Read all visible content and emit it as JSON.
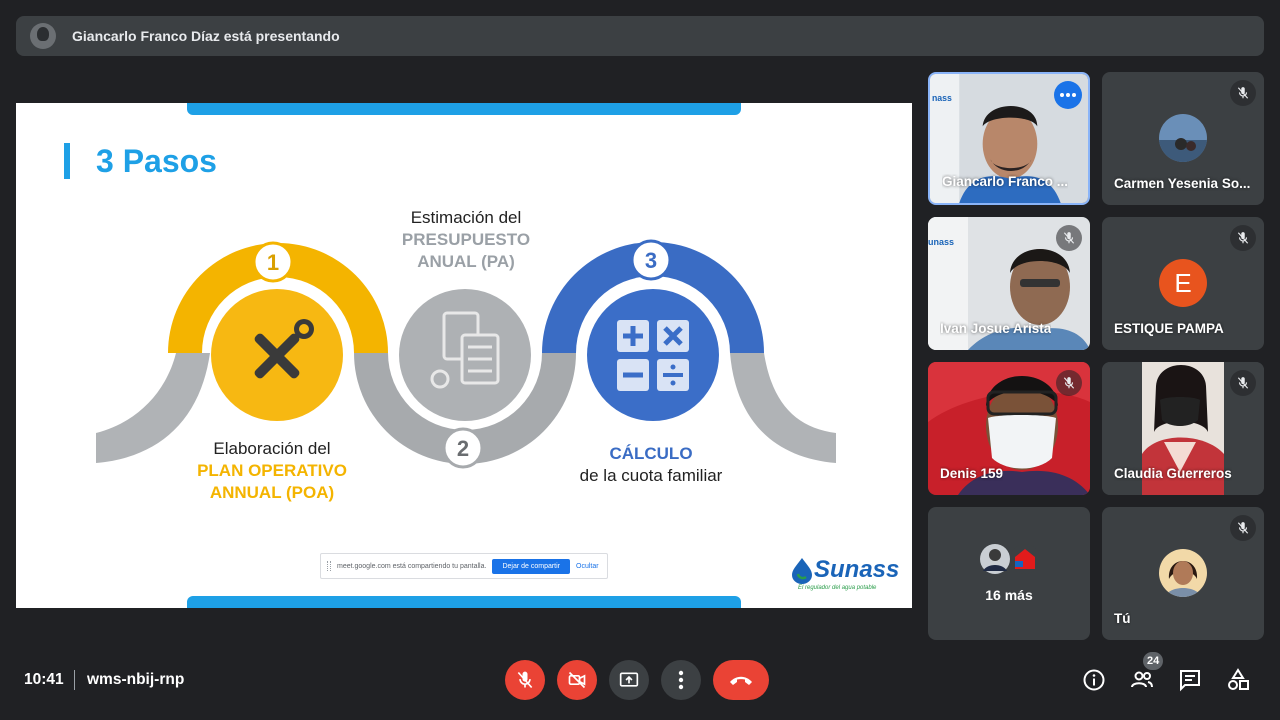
{
  "presenter": {
    "text": "Giancarlo Franco Díaz está presentando"
  },
  "slide": {
    "title": "3 Pasos",
    "step1": {
      "number": "1",
      "line1": "Elaboración del",
      "line2": "PLAN OPERATIVO",
      "line3": "ANNUAL (POA)"
    },
    "step2": {
      "number": "2",
      "line1": "Estimación del",
      "line2": "PRESUPUESTO",
      "line3": "ANUAL (PA)"
    },
    "step3": {
      "number": "3",
      "line1": "CÁLCULO",
      "line2": "de la cuota familiar"
    },
    "share_banner": {
      "message": "meet.google.com está compartiendo tu pantalla.",
      "stop_label": "Dejar de compartir",
      "hide_label": "Ocultar"
    },
    "logo": {
      "name": "Sunass",
      "tagline": "El regulador del agua potable"
    }
  },
  "participants": [
    {
      "name": "Giancarlo Franco ...",
      "active": true
    },
    {
      "name": "Carmen Yesenia So...",
      "muted": true
    },
    {
      "name": "Ivan Josue Arista",
      "muted": true
    },
    {
      "name": "ESTIQUE PAMPA",
      "muted": true,
      "initial": "E"
    },
    {
      "name": "Denis 159",
      "muted": true
    },
    {
      "name": "Claudia Guerreros",
      "muted": true
    },
    {
      "name": "16 más"
    },
    {
      "name": "Tú",
      "muted": true
    }
  ],
  "bottom": {
    "time": "10:41",
    "meeting_code": "wms-nbij-rnp",
    "participant_count": "24"
  },
  "colors": {
    "accent_blue": "#1ea0e6",
    "step1": "#f4b400",
    "step2": "#9aa0a6",
    "step3": "#3a6cc4",
    "danger": "#ea4335"
  }
}
